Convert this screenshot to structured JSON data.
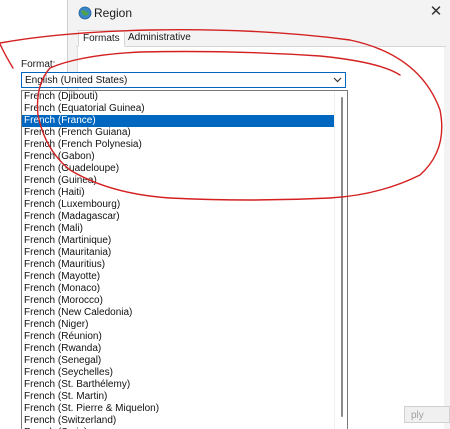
{
  "window": {
    "title": "Region",
    "close_glyph": "✕"
  },
  "tabs": [
    {
      "label": "Formats"
    },
    {
      "label": "Administrative"
    }
  ],
  "format": {
    "label": "Format:",
    "selected": "English (United States)"
  },
  "dropdown_items": [
    "French (Djibouti)",
    "French (Equatorial Guinea)",
    "French (France)",
    "French (French Guiana)",
    "French (French Polynesia)",
    "French (Gabon)",
    "French (Guadeloupe)",
    "French (Guinea)",
    "French (Haiti)",
    "French (Luxembourg)",
    "French (Madagascar)",
    "French (Mali)",
    "French (Martinique)",
    "French (Mauritania)",
    "French (Mauritius)",
    "French (Mayotte)",
    "French (Monaco)",
    "French (Morocco)",
    "French (New Caledonia)",
    "French (Niger)",
    "French (Réunion)",
    "French (Rwanda)",
    "French (Senegal)",
    "French (Seychelles)",
    "French (St. Barthélemy)",
    "French (St. Martin)",
    "French (St. Pierre & Miquelon)",
    "French (Switzerland)",
    "French (Syria)"
  ],
  "highlighted_item": "French (France)",
  "apply_button": "ply",
  "colors": {
    "accent": "#0067c0",
    "annotation": "#d42020"
  }
}
